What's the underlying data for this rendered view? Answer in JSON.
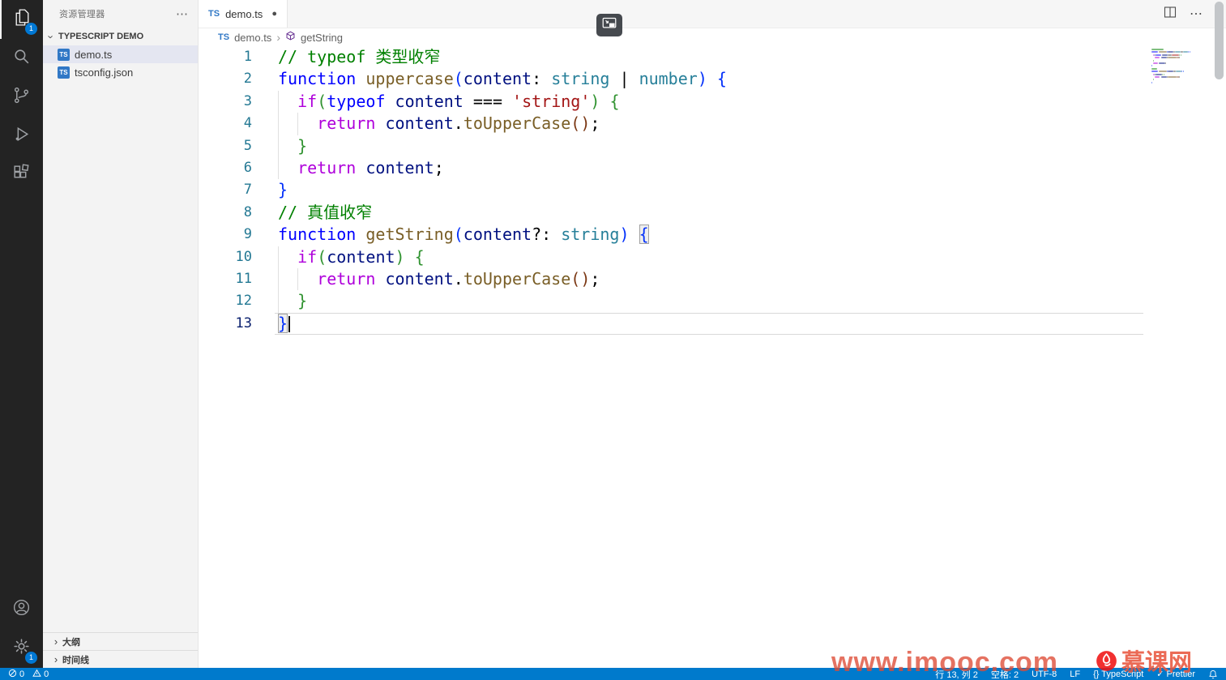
{
  "activity_bar": {
    "top": [
      {
        "name": "explorer",
        "badge": "1",
        "active": true
      },
      {
        "name": "search"
      },
      {
        "name": "source-control"
      },
      {
        "name": "run-debug"
      },
      {
        "name": "extensions"
      }
    ],
    "bottom": [
      {
        "name": "account"
      },
      {
        "name": "settings",
        "badge": "1"
      }
    ]
  },
  "sidebar": {
    "header_title": "资源管理器",
    "header_more": "⋯",
    "section_label": "TYPESCRIPT DEMO",
    "files": [
      {
        "label": "demo.ts",
        "icon": "TS",
        "selected": true
      },
      {
        "label": "tsconfig.json",
        "icon": "TS",
        "selected": false
      }
    ],
    "bottom_sections": [
      {
        "label": "大纲"
      },
      {
        "label": "时间线"
      }
    ]
  },
  "editor": {
    "tab": {
      "icon_label": "TS",
      "title": "demo.ts",
      "modified": true,
      "modified_dot": "●"
    },
    "breadcrumb": {
      "file_icon": "TS",
      "file": "demo.ts",
      "separator": "›",
      "symbol": "getString"
    },
    "active_line": 13,
    "code": [
      {
        "n": 1,
        "tokens": [
          [
            "// typeof 类型收窄",
            "cm"
          ]
        ]
      },
      {
        "n": 2,
        "tokens": [
          [
            "function",
            "kw1"
          ],
          [
            " ",
            ""
          ],
          [
            "uppercase",
            "fn"
          ],
          [
            "(",
            "b1"
          ],
          [
            "content",
            "vr"
          ],
          [
            ": ",
            ""
          ],
          [
            "string",
            "ty"
          ],
          [
            " | ",
            ""
          ],
          [
            "number",
            "ty"
          ],
          [
            ")",
            "b1"
          ],
          [
            " ",
            ""
          ],
          [
            "{",
            "b1"
          ]
        ]
      },
      {
        "n": 3,
        "g": [
          0
        ],
        "tokens": [
          [
            "  ",
            ""
          ],
          [
            "if",
            "kw2"
          ],
          [
            "(",
            "b2"
          ],
          [
            "typeof",
            "kw1"
          ],
          [
            " ",
            ""
          ],
          [
            "content",
            "vr"
          ],
          [
            " === ",
            ""
          ],
          [
            "'string'",
            "st"
          ],
          [
            ")",
            "b2"
          ],
          [
            " ",
            ""
          ],
          [
            "{",
            "b2"
          ]
        ]
      },
      {
        "n": 4,
        "g": [
          0,
          2
        ],
        "tokens": [
          [
            "    ",
            ""
          ],
          [
            "return",
            "kw2"
          ],
          [
            " ",
            ""
          ],
          [
            "content",
            "vr"
          ],
          [
            ".",
            ""
          ],
          [
            "toUpperCase",
            "fn"
          ],
          [
            "(",
            "b3"
          ],
          [
            ")",
            "b3"
          ],
          [
            ";",
            ""
          ]
        ]
      },
      {
        "n": 5,
        "g": [
          0
        ],
        "tokens": [
          [
            "  ",
            ""
          ],
          [
            "}",
            "b2"
          ]
        ]
      },
      {
        "n": 6,
        "g": [
          0
        ],
        "tokens": [
          [
            "  ",
            ""
          ],
          [
            "return",
            "kw2"
          ],
          [
            " ",
            ""
          ],
          [
            "content",
            "vr"
          ],
          [
            ";",
            ""
          ]
        ]
      },
      {
        "n": 7,
        "tokens": [
          [
            "}",
            "b1"
          ]
        ]
      },
      {
        "n": 8,
        "tokens": [
          [
            "// 真值收窄",
            "cm"
          ]
        ]
      },
      {
        "n": 9,
        "tokens": [
          [
            "function",
            "kw1"
          ],
          [
            " ",
            ""
          ],
          [
            "getString",
            "fn"
          ],
          [
            "(",
            "b1"
          ],
          [
            "content",
            "vr"
          ],
          [
            "?: ",
            ""
          ],
          [
            "string",
            "ty"
          ],
          [
            ")",
            "b1"
          ],
          [
            " ",
            ""
          ],
          [
            "{",
            "b1 match"
          ]
        ]
      },
      {
        "n": 10,
        "g": [
          0
        ],
        "tokens": [
          [
            "  ",
            ""
          ],
          [
            "if",
            "kw2"
          ],
          [
            "(",
            "b2"
          ],
          [
            "content",
            "vr"
          ],
          [
            ")",
            "b2"
          ],
          [
            " ",
            ""
          ],
          [
            "{",
            "b2"
          ]
        ]
      },
      {
        "n": 11,
        "g": [
          0,
          2
        ],
        "tokens": [
          [
            "    ",
            ""
          ],
          [
            "return",
            "kw2"
          ],
          [
            " ",
            ""
          ],
          [
            "content",
            "vr"
          ],
          [
            ".",
            ""
          ],
          [
            "toUpperCase",
            "fn"
          ],
          [
            "(",
            "b3"
          ],
          [
            ")",
            "b3"
          ],
          [
            ";",
            ""
          ]
        ]
      },
      {
        "n": 12,
        "g": [
          0
        ],
        "tokens": [
          [
            "  ",
            ""
          ],
          [
            "}",
            "b2"
          ]
        ]
      },
      {
        "n": 13,
        "tokens": [
          [
            "}",
            "b1 match"
          ]
        ]
      }
    ]
  },
  "status_bar": {
    "problems": [
      {
        "kind": "errors",
        "count": "0"
      },
      {
        "kind": "warnings",
        "count": "0"
      }
    ],
    "right_items": [
      {
        "name": "status-cursor-position",
        "label": "行 13, 列 2"
      },
      {
        "name": "status-indentation",
        "label": "空格: 2"
      },
      {
        "name": "status-encoding",
        "label": "UTF-8"
      },
      {
        "name": "status-eol",
        "label": "LF"
      },
      {
        "name": "status-language",
        "icon": "{}",
        "label": "TypeScript"
      },
      {
        "name": "status-formatter",
        "icon": "✓",
        "label": "Prettier"
      }
    ]
  },
  "overlay": {
    "watermark_text": "www.imooc.com",
    "brand_text": "慕课网"
  }
}
